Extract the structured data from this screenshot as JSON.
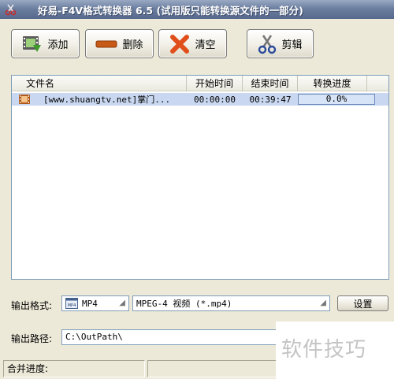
{
  "window": {
    "title": "好易-F4V格式转换器 6.5 (试用版只能转换源文件的一部分)"
  },
  "toolbar": {
    "add_label": "添加",
    "delete_label": "删除",
    "clear_label": "清空",
    "cut_label": "剪辑"
  },
  "file_list": {
    "columns": [
      "文件名",
      "开始时间",
      "结束时间",
      "转换进度"
    ],
    "rows": [
      {
        "name": "[www.shuangtv.net]掌门...",
        "start": "00:00:00",
        "end": "00:39:47",
        "progress": "0.0%"
      }
    ]
  },
  "output": {
    "format_label": "输出格式:",
    "format_value": "MP4",
    "format_icon_text": "MP4",
    "format_desc": "MPEG-4 视频 (*.mp4)",
    "settings_label": "设置",
    "path_label": "输出路径:",
    "path_value": "C:\\OutPath\\"
  },
  "status": {
    "merge_label": "合并进度:"
  },
  "watermark": "软件技巧",
  "colors": {
    "titlebar": "#6c7fa0",
    "selected_row": "#c9d8f0",
    "delete_icon": "#c85a17",
    "clear_icon": "#e04e1a"
  },
  "icons": {
    "app": "scissors-icon",
    "add": "film-add-icon",
    "delete": "minus-bar-icon",
    "clear": "x-icon",
    "cut": "scissors-icon",
    "file": "film-icon"
  }
}
